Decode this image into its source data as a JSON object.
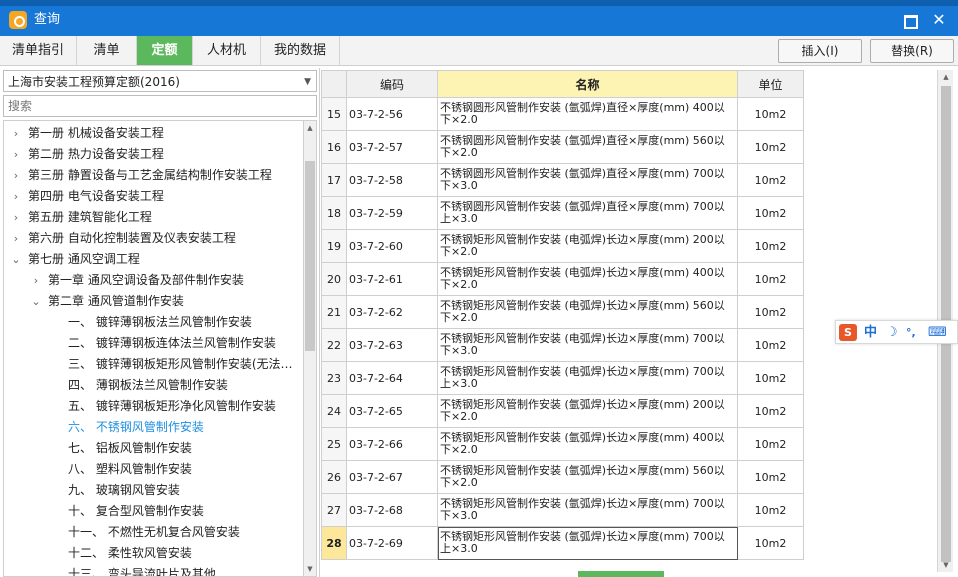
{
  "window": {
    "title": "查询",
    "maximize_label": "",
    "close_label": "✕"
  },
  "tabs": [
    {
      "label": "清单指引"
    },
    {
      "label": "清单"
    },
    {
      "label": "定额",
      "active": true
    },
    {
      "label": "人材机"
    },
    {
      "label": "我的数据"
    }
  ],
  "actions": {
    "insert_label": "插入(I)",
    "replace_label": "替换(R)"
  },
  "left": {
    "quota_set": "上海市安装工程预算定额(2016)",
    "search_placeholder": "搜索",
    "tree": [
      {
        "label": "第一册  机械设备安装工程",
        "level": 0,
        "expanded": false
      },
      {
        "label": "第二册  热力设备安装工程",
        "level": 0,
        "expanded": false
      },
      {
        "label": "第三册  静置设备与工艺金属结构制作安装工程",
        "level": 0,
        "expanded": false
      },
      {
        "label": "第四册  电气设备安装工程",
        "level": 0,
        "expanded": false
      },
      {
        "label": "第五册  建筑智能化工程",
        "level": 0,
        "expanded": false
      },
      {
        "label": "第六册  自动化控制装置及仪表安装工程",
        "level": 0,
        "expanded": false
      },
      {
        "label": "第七册  通风空调工程",
        "level": 0,
        "expanded": true
      },
      {
        "label": "第一章  通风空调设备及部件制作安装",
        "level": 1,
        "expanded": false
      },
      {
        "label": "第二章  通风管道制作安装",
        "level": 1,
        "expanded": true
      },
      {
        "label": "一、  镀锌薄钢板法兰风管制作安装",
        "level": 2
      },
      {
        "label": "二、  镀锌薄钢板连体法兰风管制作安装",
        "level": 2
      },
      {
        "label": "三、  镀锌薄钢板矩形风管制作安装(无法…",
        "level": 2
      },
      {
        "label": "四、  薄钢板法兰风管制作安装",
        "level": 2
      },
      {
        "label": "五、  镀锌薄钢板矩形净化风管制作安装",
        "level": 2
      },
      {
        "label": "六、  不锈钢风管制作安装",
        "level": 2,
        "selected": true
      },
      {
        "label": "七、  铝板风管制作安装",
        "level": 2
      },
      {
        "label": "八、  塑料风管制作安装",
        "level": 2
      },
      {
        "label": "九、  玻璃钢风管安装",
        "level": 2
      },
      {
        "label": "十、  复合型风管制作安装",
        "level": 2
      },
      {
        "label": "十一、  不燃性无机复合风管安装",
        "level": 2
      },
      {
        "label": "十二、  柔性软风管安装",
        "level": 2
      },
      {
        "label": "十三、  弯头导流叶片及其他",
        "level": 2
      }
    ]
  },
  "grid": {
    "columns": {
      "code": "编码",
      "name": "名称",
      "unit": "单位"
    },
    "rows": [
      {
        "num": "15",
        "code": "03-7-2-56",
        "name": "不锈钢圆形风管制作安装 (氩弧焊)直径×厚度(mm) 400以下×2.0",
        "unit": "10m2"
      },
      {
        "num": "16",
        "code": "03-7-2-57",
        "name": "不锈钢圆形风管制作安装 (氩弧焊)直径×厚度(mm) 560以下×2.0",
        "unit": "10m2"
      },
      {
        "num": "17",
        "code": "03-7-2-58",
        "name": "不锈钢圆形风管制作安装 (氩弧焊)直径×厚度(mm) 700以下×3.0",
        "unit": "10m2"
      },
      {
        "num": "18",
        "code": "03-7-2-59",
        "name": "不锈钢圆形风管制作安装 (氩弧焊)直径×厚度(mm) 700以上×3.0",
        "unit": "10m2"
      },
      {
        "num": "19",
        "code": "03-7-2-60",
        "name": "不锈钢矩形风管制作安装 (电弧焊)长边×厚度(mm) 200以下×2.0",
        "unit": "10m2"
      },
      {
        "num": "20",
        "code": "03-7-2-61",
        "name": "不锈钢矩形风管制作安装 (电弧焊)长边×厚度(mm) 400以下×2.0",
        "unit": "10m2"
      },
      {
        "num": "21",
        "code": "03-7-2-62",
        "name": "不锈钢矩形风管制作安装 (电弧焊)长边×厚度(mm) 560以下×2.0",
        "unit": "10m2"
      },
      {
        "num": "22",
        "code": "03-7-2-63",
        "name": "不锈钢矩形风管制作安装 (电弧焊)长边×厚度(mm) 700以下×3.0",
        "unit": "10m2"
      },
      {
        "num": "23",
        "code": "03-7-2-64",
        "name": "不锈钢矩形风管制作安装 (电弧焊)长边×厚度(mm) 700以上×3.0",
        "unit": "10m2"
      },
      {
        "num": "24",
        "code": "03-7-2-65",
        "name": "不锈钢矩形风管制作安装 (氩弧焊)长边×厚度(mm) 200以下×2.0",
        "unit": "10m2"
      },
      {
        "num": "25",
        "code": "03-7-2-66",
        "name": "不锈钢矩形风管制作安装 (氩弧焊)长边×厚度(mm) 400以下×2.0",
        "unit": "10m2"
      },
      {
        "num": "26",
        "code": "03-7-2-67",
        "name": "不锈钢矩形风管制作安装 (氩弧焊)长边×厚度(mm) 560以下×2.0",
        "unit": "10m2"
      },
      {
        "num": "27",
        "code": "03-7-2-68",
        "name": "不锈钢矩形风管制作安装 (氩弧焊)长边×厚度(mm) 700以下×3.0",
        "unit": "10m2"
      },
      {
        "num": "28",
        "code": "03-7-2-69",
        "name": "不锈钢矩形风管制作安装 (氩弧焊)长边×厚度(mm) 700以上×3.0",
        "unit": "10m2",
        "active": true
      }
    ]
  },
  "ime": {
    "logo": "S",
    "mode": "中",
    "punct": "☽",
    "symbols": "°,",
    "keyboard": "⌨"
  },
  "colors": {
    "titlebar": "#1677d6",
    "active_tab": "#5cb85c",
    "name_header": "#fdf3b2",
    "selected_tree": "#1f8fe0"
  }
}
